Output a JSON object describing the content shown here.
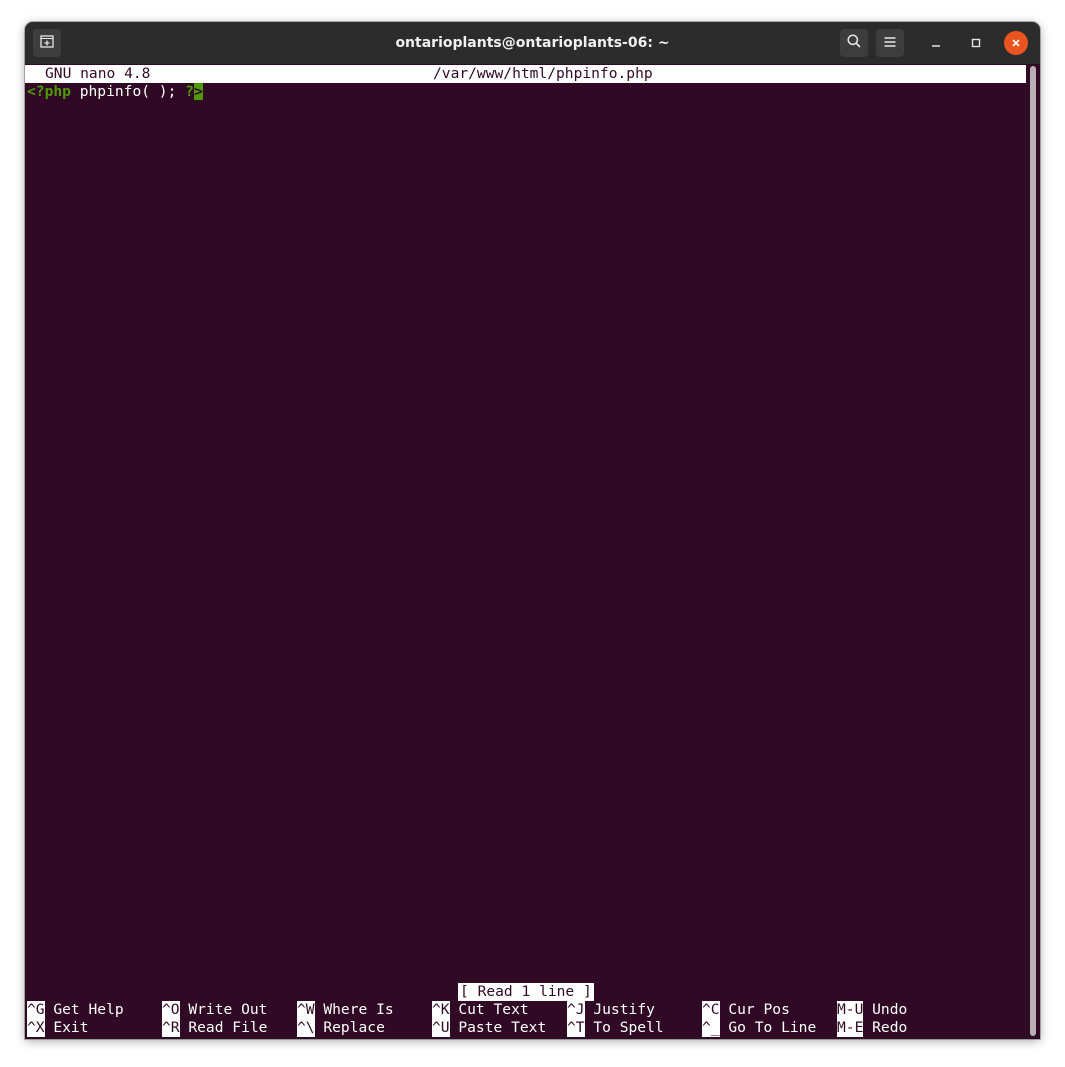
{
  "window": {
    "title": "ontarioplants@ontarioplants-06: ~"
  },
  "icons": {
    "new_tab": "new-tab-icon",
    "search": "search-icon",
    "menu": "hamburger-menu-icon",
    "minimize": "minimize-icon",
    "maximize": "maximize-icon",
    "close": "close-icon"
  },
  "nano": {
    "version": "GNU nano 4.8",
    "filename": "/var/www/html/phpinfo.php",
    "code": {
      "open_tag": "<?php",
      "body": " phpinfo( ); ",
      "close_tag_q": "?",
      "close_tag_gt": ">"
    },
    "status_message": "[ Read 1 line ]",
    "shortcuts_row1": [
      {
        "key": "^G",
        "label": " Get Help"
      },
      {
        "key": "^O",
        "label": " Write Out"
      },
      {
        "key": "^W",
        "label": " Where Is"
      },
      {
        "key": "^K",
        "label": " Cut Text"
      },
      {
        "key": "^J",
        "label": " Justify"
      },
      {
        "key": "^C",
        "label": " Cur Pos"
      },
      {
        "key": "M-U",
        "label": " Undo"
      }
    ],
    "shortcuts_row2": [
      {
        "key": "^X",
        "label": " Exit"
      },
      {
        "key": "^R",
        "label": " Read File"
      },
      {
        "key": "^\\",
        "label": " Replace"
      },
      {
        "key": "^U",
        "label": " Paste Text"
      },
      {
        "key": "^T",
        "label": " To Spell"
      },
      {
        "key": "^_",
        "label": " Go To Line"
      },
      {
        "key": "M-E",
        "label": " Redo"
      }
    ]
  },
  "colors": {
    "terminal_bg": "#300a24",
    "titlebar_bg": "#2c2c2c",
    "php_tag_green": "#4e9a06",
    "close_button_orange": "#e95420"
  }
}
